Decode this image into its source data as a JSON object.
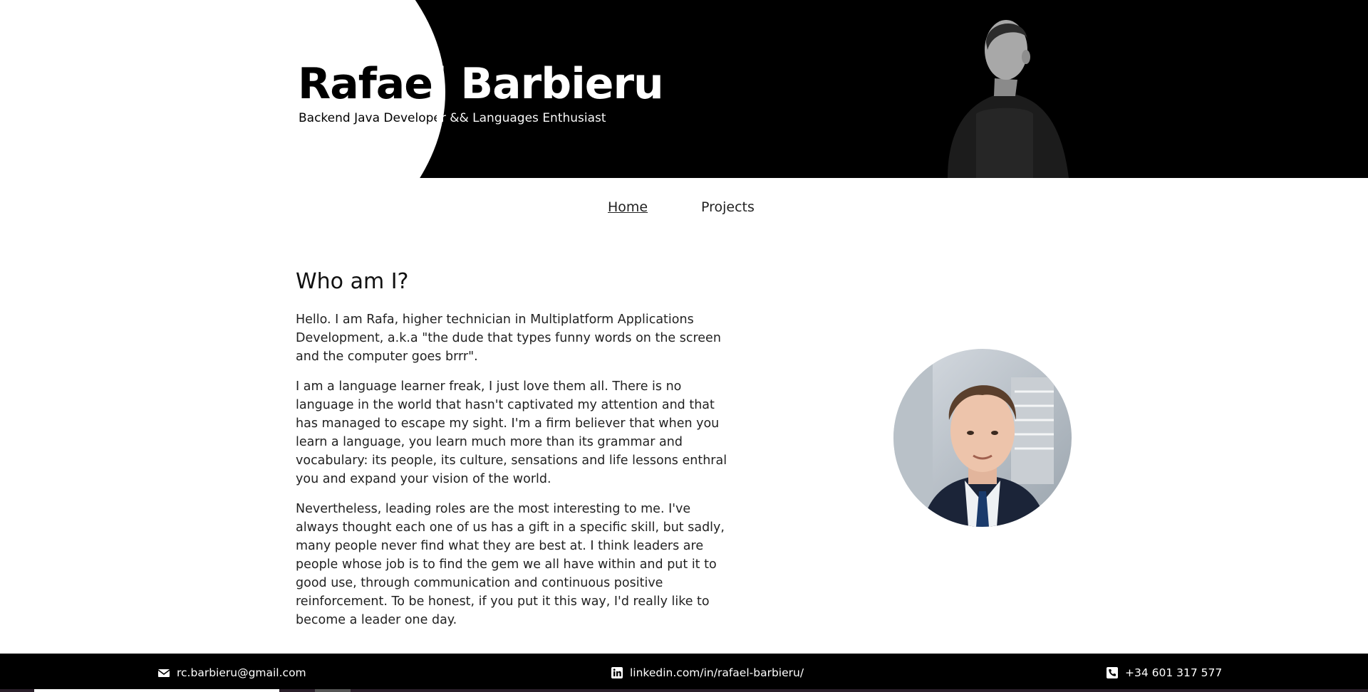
{
  "header": {
    "name": "Rafael Barbieru",
    "subtitle": "Backend Java Developer && Languages Enthusiast"
  },
  "nav": {
    "items": [
      {
        "label": "Home",
        "active": true
      },
      {
        "label": "Projects",
        "active": false
      }
    ]
  },
  "about": {
    "heading": "Who am I?",
    "paragraphs": [
      "Hello. I am Rafa, higher technician in Multiplatform Applications Development, a.k.a \"the dude that types funny words on the screen and the computer goes brrr\".",
      "I am a language learner freak, I just love them all. There is no language in the world that hasn't captivated my attention and that has managed to escape my sight. I'm a firm believer that when you learn a language, you learn much more than its grammar and vocabulary: its people, its culture, sensations and life lessons enthral you and expand your vision of the world.",
      "Nevertheless, leading roles are the most interesting to me. I've always thought each one of us has a gift in a specific skill, but sadly, many people never find what they are best at. I think leaders are people whose job is to find the gem we all have within and put it to good use, through communication and continuous positive reinforcement. To be honest, if you put it this way, I'd really like to become a leader one day."
    ]
  },
  "footer": {
    "email": "rc.barbieru@gmail.com",
    "linkedin": "linkedin.com/in/rafael-barbieru/",
    "phone": "+34 601 317 577",
    "icons": [
      "envelope-icon",
      "linkedin-icon",
      "phone-icon"
    ]
  },
  "colors": {
    "banner": "#000000",
    "footer": "#000000",
    "text": "#222222"
  }
}
